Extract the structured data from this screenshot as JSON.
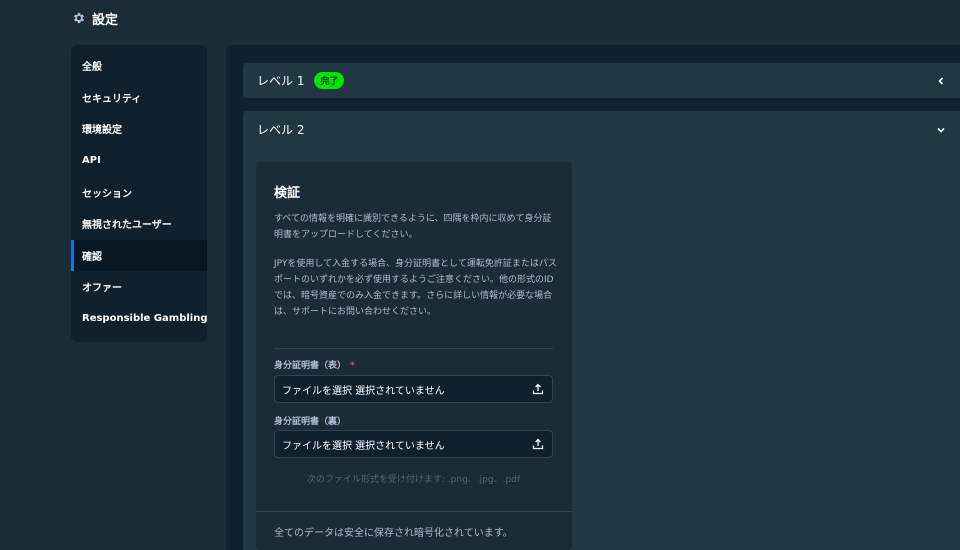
{
  "header": {
    "icon": "gear-icon",
    "title": "設定"
  },
  "sidebar": {
    "active_index": 6,
    "accent_color": "#1475e1",
    "items": [
      {
        "label": "全般"
      },
      {
        "label": "セキュリティ"
      },
      {
        "label": "環境設定"
      },
      {
        "label": "API"
      },
      {
        "label": "セッション"
      },
      {
        "label": "無視されたユーザー"
      },
      {
        "label": "確認"
      },
      {
        "label": "オファー"
      },
      {
        "label": "Responsible Gambling"
      }
    ]
  },
  "levels": [
    {
      "label": "レベル 1",
      "badge": "完了",
      "badge_color": "#00e701",
      "icon": "chevron-left-icon"
    },
    {
      "label": "レベル 2",
      "icon": "chevron-down-icon"
    }
  ],
  "verification": {
    "title": "検証",
    "paragraph1": "すべての情報を明確に識別できるように、四隅を枠内に収めて身分証明書をアップロードしてください。",
    "paragraph2": "JPYを使用して入金する場合、身分証明書として運転免許証またはパスポートのいずれかを必ず使用するようご注意ください。他の形式のIDでは、暗号資産でのみ入金できます。さらに詳しい情報が必要な場合は、サポートにお問い合わせください。",
    "front_label": "身分証明書（表）",
    "required_mark": "*",
    "back_label": "身分証明書（裏）",
    "front_value": "ファイルを選択 選択されていません",
    "back_value": "ファイルを選択 選択されていません",
    "upload_icon": "upload-icon",
    "accepted_formats": "次のファイル形式を受け付けます: .png、.jpg、.pdf",
    "footer": "全てのデータは安全に保存され暗号化されています。"
  }
}
